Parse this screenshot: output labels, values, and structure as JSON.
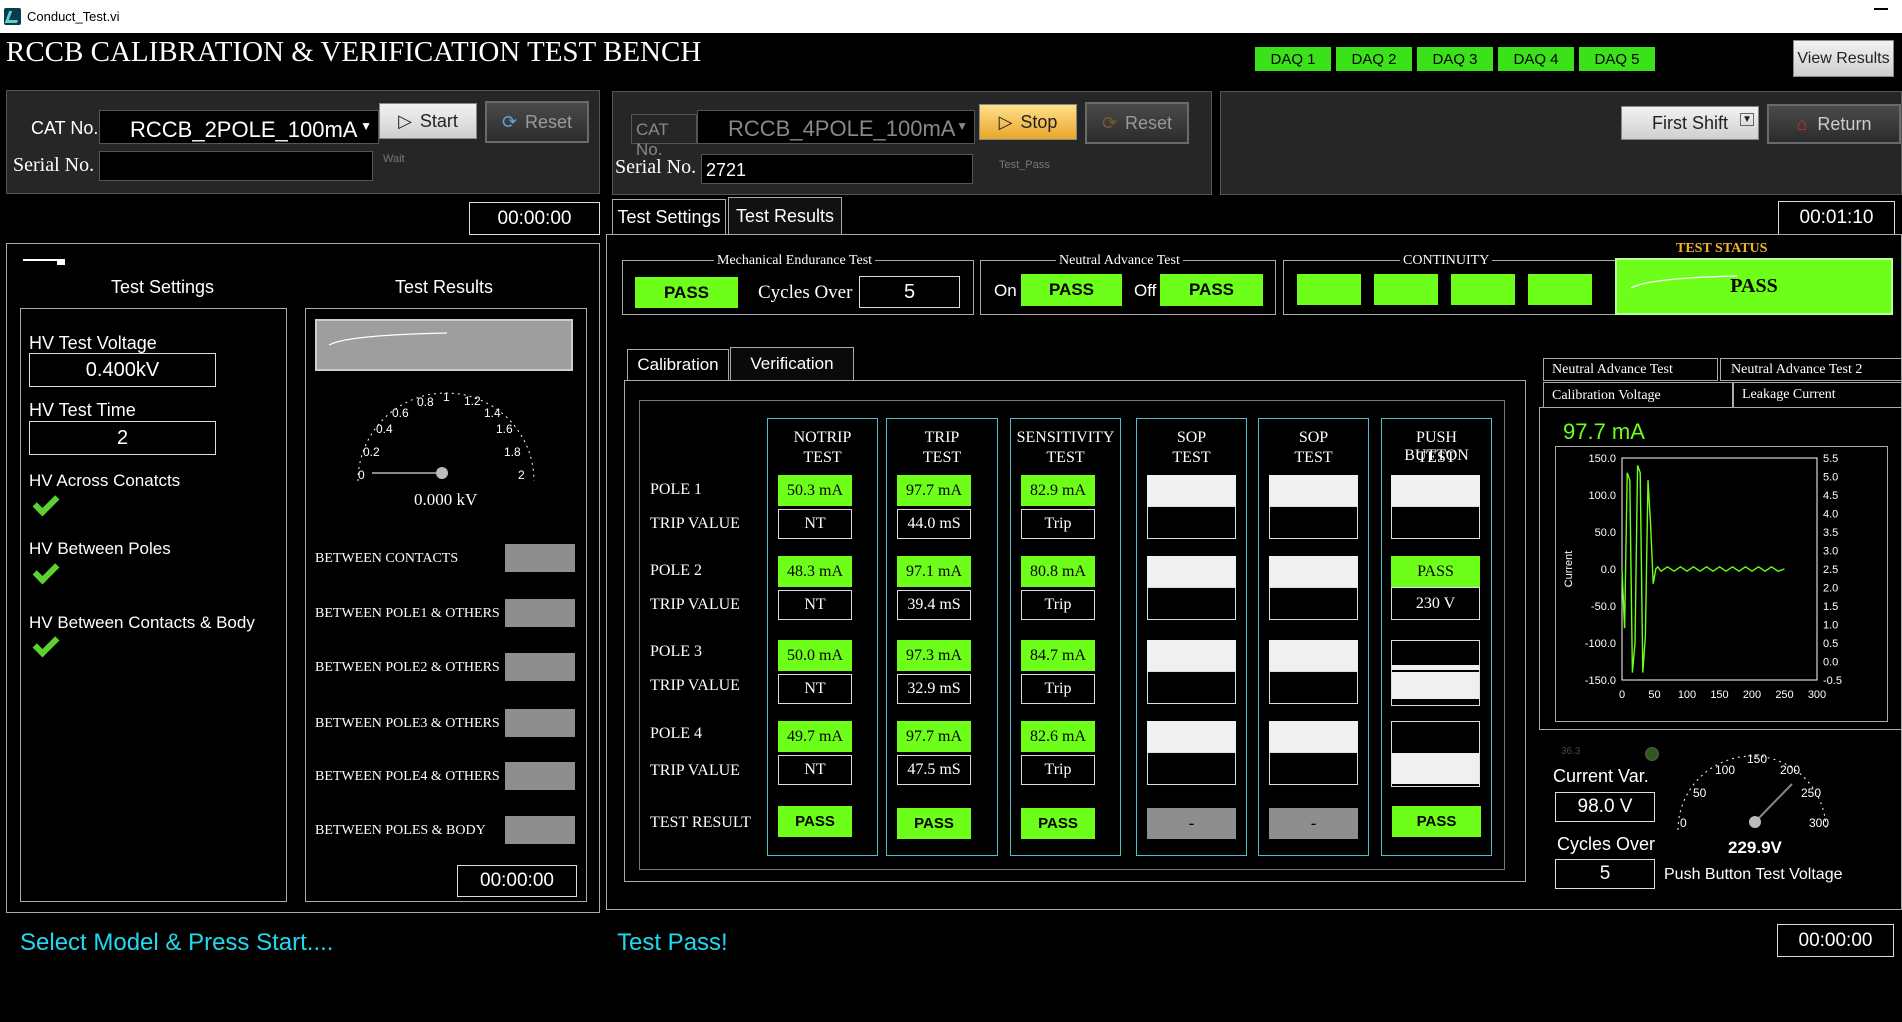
{
  "window": {
    "title": "Conduct_Test.vi"
  },
  "app": {
    "title": "RCCB CALIBRATION & VERIFICATION TEST BENCH",
    "view_results": "View Results"
  },
  "daq": [
    "DAQ 1",
    "DAQ 2",
    "DAQ 3",
    "DAQ 4",
    "DAQ 5"
  ],
  "left": {
    "cat_label": "CAT No.",
    "cat_value": "RCCB_2POLE_100mA",
    "start": "Start",
    "reset": "Reset",
    "serial_label": "Serial No.",
    "serial_value": "",
    "wait": "Wait",
    "timer": "00:00:00",
    "settings_title": "Test Settings",
    "results_title": "Test Results",
    "hv_voltage_label": "HV Test Voltage",
    "hv_voltage_value": "0.400kV",
    "hv_time_label": "HV Test Time",
    "hv_time_value": "2",
    "hv_across": "HV Across Conatcts",
    "hv_between_poles": "HV Between Poles",
    "hv_contacts_body": "HV Between Contacts & Body",
    "gauge_ticks": [
      "0",
      "0.2",
      "0.4",
      "0.6",
      "0.8",
      "1",
      "1.2",
      "1.4",
      "1.6",
      "1.8",
      "2"
    ],
    "gauge_value": "0.000 kV",
    "between": [
      "BETWEEN CONTACTS",
      "BETWEEN POLE1 & OTHERS",
      "BETWEEN POLE2 & OTHERS",
      "BETWEEN POLE3 & OTHERS",
      "BETWEEN POLE4 & OTHERS",
      "BETWEEN POLES & BODY"
    ],
    "results_timer": "00:00:00",
    "status": "Select Model & Press Start...."
  },
  "mid": {
    "cat_label": "CAT No.",
    "cat_value": "RCCB_4POLE_100mA",
    "stop": "Stop",
    "reset": "Reset",
    "serial_label": "Serial No.",
    "serial_value": "2721",
    "test_pass_small": "Test_Pass",
    "tab_settings": "Test Settings",
    "tab_results": "Test Results",
    "timer": "00:01:10",
    "mech_title": "Mechanical Endurance Test",
    "mech_pass": "PASS",
    "cycles_label": "Cycles Over",
    "cycles_value": "5",
    "neutral_title": "Neutral Advance Test",
    "on": "On",
    "on_pass": "PASS",
    "off": "Off",
    "off_pass": "PASS",
    "continuity_title": "CONTINUITY",
    "status_title": "TEST STATUS",
    "status_value": "PASS",
    "tab_calibration": "Calibration",
    "tab_verification": "Verification",
    "rows": [
      "POLE  1",
      "TRIP VALUE",
      "POLE  2",
      "TRIP VALUE",
      "POLE  3",
      "TRIP VALUE",
      "POLE  4",
      "TRIP VALUE",
      "TEST  RESULT"
    ],
    "columns": [
      {
        "h1": "NOTRIP",
        "h2": "TEST",
        "v": [
          "50.3 mA",
          "NT",
          "48.3 mA",
          "NT",
          "50.0 mA",
          "NT",
          "49.7 mA",
          "NT"
        ],
        "result": "PASS"
      },
      {
        "h1": "TRIP",
        "h2": "TEST",
        "v": [
          "97.7 mA",
          "44.0 mS",
          "97.1 mA",
          "39.4 mS",
          "97.3 mA",
          "32.9 mS",
          "97.7 mA",
          "47.5 mS"
        ],
        "result": "PASS"
      },
      {
        "h1": "SENSITIVITY",
        "h2": "TEST",
        "v": [
          "82.9 mA",
          "Trip",
          "80.8 mA",
          "Trip",
          "84.7 mA",
          "Trip",
          "82.6 mA",
          "Trip"
        ],
        "result": "PASS"
      },
      {
        "h1": "SOP",
        "h2": "TEST",
        "v": [
          "",
          "",
          "",
          "",
          "",
          "",
          "",
          ""
        ],
        "result": "-"
      },
      {
        "h1": "SOP",
        "h2": "TEST",
        "v": [
          "",
          "",
          "",
          "",
          "",
          "",
          "",
          ""
        ],
        "result": "-"
      },
      {
        "h1": "PUSH BUTTON",
        "h2": "TEST",
        "v": [
          "",
          "",
          "PASS",
          "230 V",
          "",
          "",
          "",
          ""
        ],
        "result": "PASS"
      }
    ],
    "status": "Test Pass!"
  },
  "right": {
    "shift": "First Shift",
    "return": "Return",
    "tabs": [
      "Neutral Advance Test",
      "Neutral Advance Test 2",
      "Calibration Voltage",
      "Leakage Current"
    ],
    "current_value": "97.7 mA",
    "y_axis_label": "Current",
    "current_var_label": "Current Var.",
    "current_var_value": "98.0 V",
    "cycles_label": "Cycles Over",
    "cycles_value": "5",
    "dim_value": "36.3",
    "pb_gauge_ticks": [
      "0",
      "50",
      "100",
      "150",
      "200",
      "250",
      "300"
    ],
    "pb_gauge_value": "229.9V",
    "pb_label": "Push Button Test Voltage",
    "timer": "00:00:00"
  },
  "chart_data": {
    "type": "line",
    "xlim": [
      0,
      300
    ],
    "ylim": [
      -150,
      150
    ],
    "y2lim": [
      -0.5,
      5.5
    ],
    "x_ticks": [
      "0",
      "50",
      "100",
      "150",
      "200",
      "250",
      "300"
    ],
    "y_ticks": [
      "150.0",
      "100.0",
      "50.0",
      "0.0",
      "-50.0",
      "-100.0",
      "-150.0"
    ],
    "y2_ticks": [
      "5.5",
      "5.0",
      "4.5",
      "4.0",
      "3.5",
      "3.0",
      "2.5",
      "2.0",
      "1.5",
      "1.0",
      "0.5",
      "0.0",
      "-0.5"
    ],
    "ylabel": "Current",
    "series": [
      {
        "color": "#6dff1a",
        "x": [
          0,
          4,
          8,
          12,
          16,
          20,
          24,
          28,
          32,
          36,
          40,
          44,
          48,
          52,
          55,
          60,
          70,
          80,
          90,
          100,
          110,
          120,
          130,
          140,
          150,
          160,
          170,
          180,
          190,
          200,
          210,
          220,
          230,
          240,
          250
        ],
        "y": [
          0,
          -80,
          130,
          120,
          -140,
          -100,
          140,
          130,
          -140,
          -90,
          120,
          60,
          -20,
          0,
          3,
          -3,
          3,
          -3,
          3,
          -3,
          3,
          -3,
          3,
          -3,
          3,
          -3,
          3,
          -3,
          3,
          -3,
          3,
          -3,
          3,
          -3,
          0
        ]
      }
    ]
  }
}
